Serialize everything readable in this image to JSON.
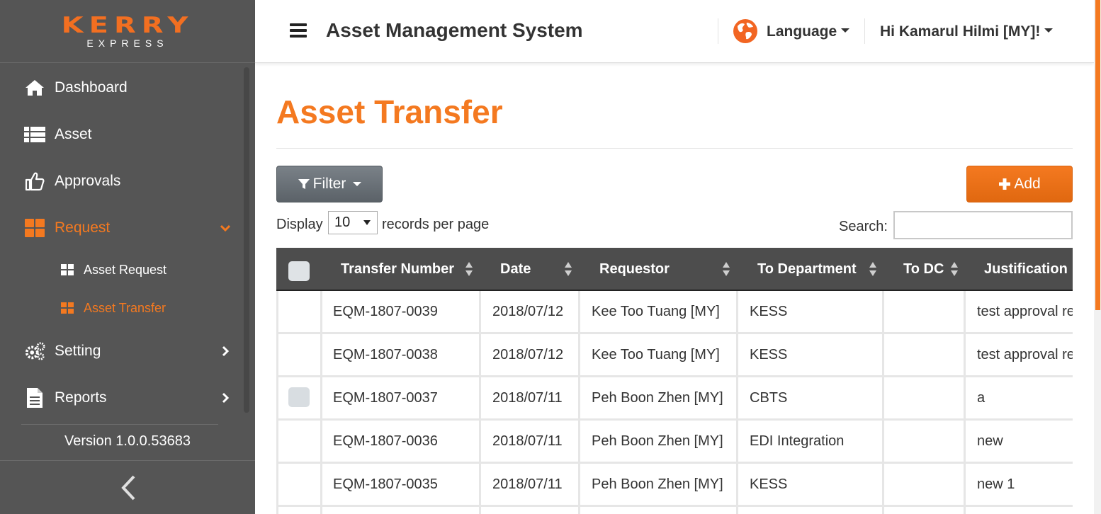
{
  "brand": {
    "logo_top": "KERRY",
    "logo_bottom": "EXPRESS",
    "accent": "#f47920"
  },
  "header": {
    "title": "Asset Management System",
    "language_label": "Language",
    "user_greeting": "Hi Kamarul Hilmi [MY]!"
  },
  "sidebar": {
    "items": [
      {
        "label": "Dashboard",
        "icon": "home-icon"
      },
      {
        "label": "Asset",
        "icon": "list-icon"
      },
      {
        "label": "Approvals",
        "icon": "thumbs-up-icon"
      },
      {
        "label": "Request",
        "icon": "grid-icon",
        "active": true,
        "expanded": true
      },
      {
        "label": "Setting",
        "icon": "gears-icon"
      },
      {
        "label": "Reports",
        "icon": "document-icon"
      }
    ],
    "sub_items": [
      {
        "label": "Asset Request",
        "active": false
      },
      {
        "label": "Asset Transfer",
        "active": true
      }
    ],
    "version": "Version 1.0.0.53683"
  },
  "page": {
    "title": "Asset Transfer",
    "filter_label": "Filter",
    "add_label": "Add",
    "display_label": "Display",
    "page_size": "10",
    "records_per_page_label": "records per page",
    "search_label": "Search:",
    "search_value": ""
  },
  "table": {
    "columns": [
      "Transfer Number",
      "Date",
      "Requestor",
      "To Department",
      "To DC",
      "Justification"
    ],
    "rows": [
      {
        "number": "EQM-1807-0039",
        "date": "2018/07/12",
        "requestor": "Kee Too Tuang [MY]",
        "department": "KESS",
        "dc": "",
        "justification": "test approval re",
        "checkbox": false
      },
      {
        "number": "EQM-1807-0038",
        "date": "2018/07/12",
        "requestor": "Kee Too Tuang [MY]",
        "department": "KESS",
        "dc": "",
        "justification": "test approval re",
        "checkbox": false
      },
      {
        "number": "EQM-1807-0037",
        "date": "2018/07/11",
        "requestor": "Peh Boon Zhen [MY]",
        "department": "CBTS",
        "dc": "",
        "justification": "a",
        "checkbox": true
      },
      {
        "number": "EQM-1807-0036",
        "date": "2018/07/11",
        "requestor": "Peh Boon Zhen [MY]",
        "department": "EDI Integration",
        "dc": "",
        "justification": "new",
        "checkbox": false
      },
      {
        "number": "EQM-1807-0035",
        "date": "2018/07/11",
        "requestor": "Peh Boon Zhen [MY]",
        "department": "KESS",
        "dc": "",
        "justification": "new 1",
        "checkbox": false
      }
    ]
  }
}
